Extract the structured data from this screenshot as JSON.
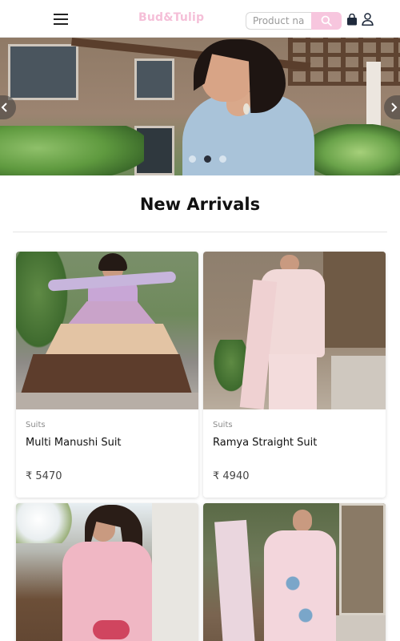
{
  "header": {
    "brand": "Bud&Tulip",
    "search": {
      "placeholder": "Product name"
    }
  },
  "hero": {
    "slides": 3,
    "active_slide": 2
  },
  "section": {
    "title": "New Arrivals"
  },
  "products": [
    {
      "category": "Suits",
      "name": "Multi Manushi Suit",
      "price": "₹ 5470"
    },
    {
      "category": "Suits",
      "name": "Ramya Straight Suit",
      "price": "₹ 4940"
    },
    {
      "category": "",
      "name": "",
      "price": ""
    },
    {
      "category": "",
      "name": "",
      "price": ""
    }
  ],
  "colors": {
    "brand_pink": "#f5bfd8",
    "search_button": "#f7c6de"
  },
  "icons": {
    "menu": "hamburger-icon",
    "search": "search-icon",
    "cart": "shopping-bag-icon",
    "user": "user-icon",
    "prev": "chevron-left-icon",
    "next": "chevron-right-icon"
  }
}
